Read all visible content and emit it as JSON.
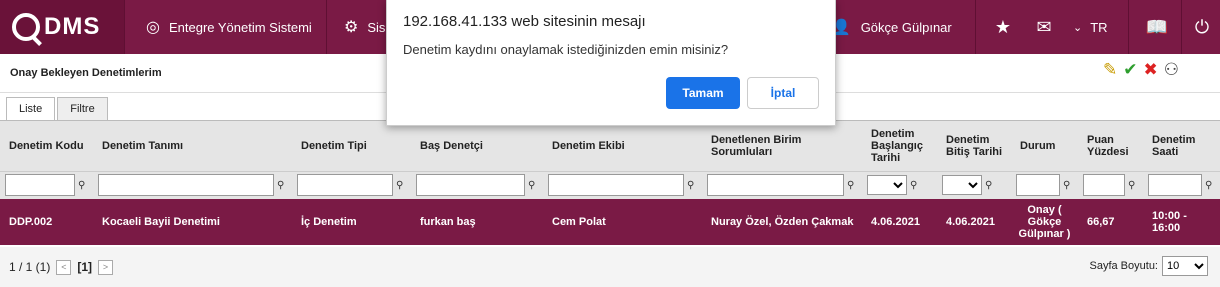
{
  "brand": {
    "logo_text": "DMS"
  },
  "nav": {
    "integrated": "Entegre Yönetim Sistemi",
    "system_partial": "Sis",
    "user": "Gökçe Gülpınar",
    "lang": "TR"
  },
  "panel": {
    "title": "Onay Bekleyen Denetimlerim"
  },
  "tabs": [
    {
      "label": "Liste"
    },
    {
      "label": "Filtre"
    }
  ],
  "table": {
    "headers": [
      "Denetim Kodu",
      "Denetim Tanımı",
      "Denetim Tipi",
      "Baş Denetçi",
      "Denetim Ekibi",
      "Denetlenen Birim Sorumluları",
      "Denetim Başlangıç Tarihi",
      "Denetim Bitiş Tarihi",
      "Durum",
      "Puan Yüzdesi",
      "Denetim Saati"
    ],
    "row": {
      "code": "DDP.002",
      "name": "Kocaeli Bayii Denetimi",
      "type": "İç Denetim",
      "lead": "furkan baş",
      "team": "Cem Polat",
      "resp": "Nuray Özel, Özden Çakmak",
      "start": "4.06.2021",
      "end": "4.06.2021",
      "status": "Onay ( Gökçe Gülpınar )",
      "score": "66,67",
      "time": "10:00 - 16:00"
    }
  },
  "footer": {
    "page_info": "1 / 1 (1)",
    "current_page": "[1]",
    "page_size_label": "Sayfa Boyutu:",
    "page_size_value": "10"
  },
  "dialog": {
    "title": "192.168.41.133 web sitesinin mesajı",
    "message": "Denetim kaydını onaylamak istediğinizden emin misiniz?",
    "ok_label": "Tamam",
    "cancel_label": "İptal"
  },
  "colors": {
    "brand": "#7a1a45",
    "primary_button": "#1a73e8"
  }
}
